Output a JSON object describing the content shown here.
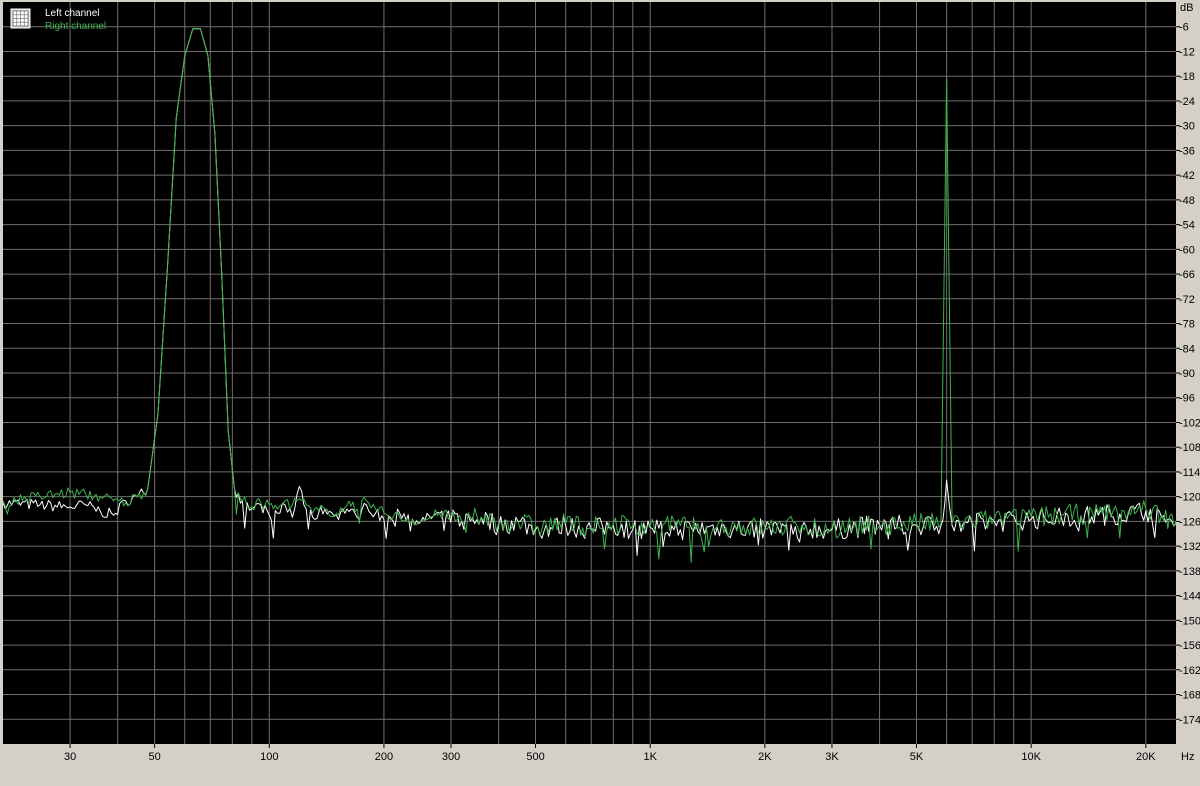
{
  "chart_data": {
    "type": "line",
    "title": "",
    "xlabel": "",
    "ylabel": "",
    "x_unit": "Hz",
    "y_unit": "dB",
    "x_scale": "log",
    "xlim": [
      20,
      24000
    ],
    "ylim": [
      -180,
      0
    ],
    "grid": true,
    "legend_position": "top-left",
    "x_ticks": [
      {
        "value": 30,
        "label": "30"
      },
      {
        "value": 50,
        "label": "50"
      },
      {
        "value": 100,
        "label": "100"
      },
      {
        "value": 200,
        "label": "200"
      },
      {
        "value": 300,
        "label": "300"
      },
      {
        "value": 500,
        "label": "500"
      },
      {
        "value": 1000,
        "label": "1K"
      },
      {
        "value": 2000,
        "label": "2K"
      },
      {
        "value": 3000,
        "label": "3K"
      },
      {
        "value": 5000,
        "label": "5K"
      },
      {
        "value": 10000,
        "label": "10K"
      },
      {
        "value": 20000,
        "label": "20K"
      }
    ],
    "x_minor_grid": [
      20,
      40,
      60,
      70,
      80,
      90,
      400,
      600,
      700,
      800,
      900,
      4000,
      6000,
      7000,
      8000,
      9000
    ],
    "y_ticks": [
      -6,
      -12,
      -18,
      -24,
      -30,
      -36,
      -42,
      -48,
      -54,
      -60,
      -66,
      -72,
      -78,
      -84,
      -90,
      -96,
      -102,
      -108,
      -114,
      -120,
      -126,
      -132,
      -138,
      -144,
      -150,
      -156,
      -162,
      -168,
      -174
    ],
    "series": [
      {
        "name": "Left channel",
        "color": "#ffffff",
        "points": [
          [
            20,
            -121.5
          ],
          [
            25,
            -122
          ],
          [
            30,
            -122.5
          ],
          [
            33,
            -122
          ],
          [
            36,
            -123.5
          ],
          [
            39,
            -124.5
          ],
          [
            42,
            -121
          ],
          [
            45,
            -120
          ],
          [
            48,
            -118
          ],
          [
            51,
            -100
          ],
          [
            54,
            -65
          ],
          [
            57,
            -28
          ],
          [
            60,
            -13
          ],
          [
            63,
            -6.5
          ],
          [
            66,
            -6.5
          ],
          [
            69,
            -13
          ],
          [
            72,
            -32
          ],
          [
            75,
            -66
          ],
          [
            78,
            -104
          ],
          [
            81,
            -118
          ],
          [
            85,
            -121
          ],
          [
            90,
            -123
          ],
          [
            95,
            -122
          ],
          [
            100,
            -124.5
          ],
          [
            105,
            -124
          ],
          [
            110,
            -122
          ],
          [
            115,
            -125
          ],
          [
            120,
            -117.5
          ],
          [
            125,
            -123
          ],
          [
            130,
            -125
          ],
          [
            140,
            -123
          ],
          [
            150,
            -124.5
          ],
          [
            160,
            -123
          ],
          [
            170,
            -125
          ],
          [
            180,
            -122
          ],
          [
            190,
            -124
          ],
          [
            200,
            -125.5
          ],
          [
            220,
            -124
          ],
          [
            250,
            -126
          ],
          [
            280,
            -124
          ],
          [
            320,
            -126
          ],
          [
            360,
            -125
          ],
          [
            400,
            -127
          ],
          [
            450,
            -126
          ],
          [
            500,
            -128
          ],
          [
            600,
            -127
          ],
          [
            700,
            -128
          ],
          [
            800,
            -127
          ],
          [
            900,
            -128
          ],
          [
            1000,
            -127.5
          ],
          [
            1200,
            -128
          ],
          [
            1500,
            -127.5
          ],
          [
            2000,
            -128
          ],
          [
            2500,
            -127.5
          ],
          [
            3000,
            -128
          ],
          [
            4000,
            -127
          ],
          [
            5000,
            -127
          ],
          [
            5800,
            -127
          ],
          [
            6000,
            -116
          ],
          [
            6200,
            -127
          ],
          [
            7000,
            -126.5
          ],
          [
            8000,
            -126
          ],
          [
            10000,
            -125.5
          ],
          [
            12000,
            -125
          ],
          [
            15000,
            -124.5
          ],
          [
            18000,
            -124
          ],
          [
            20000,
            -123.5
          ],
          [
            22000,
            -125
          ],
          [
            24000,
            -126.5
          ]
        ]
      },
      {
        "name": "Right channel",
        "color": "#3cb44b",
        "points": [
          [
            20,
            -121
          ],
          [
            25,
            -120
          ],
          [
            30,
            -119
          ],
          [
            33,
            -119.5
          ],
          [
            36,
            -120
          ],
          [
            39,
            -121
          ],
          [
            42,
            -121.5
          ],
          [
            45,
            -120
          ],
          [
            48,
            -118
          ],
          [
            51,
            -100
          ],
          [
            54,
            -65
          ],
          [
            57,
            -28
          ],
          [
            60,
            -13
          ],
          [
            63,
            -6.5
          ],
          [
            66,
            -6.5
          ],
          [
            69,
            -13
          ],
          [
            72,
            -32
          ],
          [
            75,
            -66
          ],
          [
            78,
            -104
          ],
          [
            81,
            -118
          ],
          [
            85,
            -121
          ],
          [
            90,
            -122.5
          ],
          [
            95,
            -121.5
          ],
          [
            100,
            -122
          ],
          [
            105,
            -123
          ],
          [
            110,
            -121
          ],
          [
            115,
            -122
          ],
          [
            120,
            -120.5
          ],
          [
            125,
            -122
          ],
          [
            130,
            -124
          ],
          [
            140,
            -123
          ],
          [
            150,
            -124
          ],
          [
            160,
            -122
          ],
          [
            170,
            -123
          ],
          [
            180,
            -121
          ],
          [
            190,
            -123
          ],
          [
            200,
            -124
          ],
          [
            220,
            -125
          ],
          [
            250,
            -126
          ],
          [
            280,
            -124
          ],
          [
            320,
            -126
          ],
          [
            360,
            -125
          ],
          [
            400,
            -126.5
          ],
          [
            450,
            -126
          ],
          [
            500,
            -127.5
          ],
          [
            600,
            -126.5
          ],
          [
            700,
            -127.5
          ],
          [
            800,
            -126.5
          ],
          [
            900,
            -127
          ],
          [
            1000,
            -127
          ],
          [
            1200,
            -127
          ],
          [
            1500,
            -127
          ],
          [
            2000,
            -127.5
          ],
          [
            2500,
            -127
          ],
          [
            3000,
            -127.5
          ],
          [
            4000,
            -127
          ],
          [
            5000,
            -126.5
          ],
          [
            5800,
            -126.5
          ],
          [
            6000,
            -18.5
          ],
          [
            6200,
            -126.5
          ],
          [
            7000,
            -126
          ],
          [
            8000,
            -125.5
          ],
          [
            10000,
            -125
          ],
          [
            12000,
            -124.5
          ],
          [
            15000,
            -124
          ],
          [
            18000,
            -123.5
          ],
          [
            20000,
            -123
          ],
          [
            22000,
            -124.5
          ],
          [
            24000,
            -126
          ]
        ]
      }
    ]
  },
  "legend": {
    "icon": "grid-icon",
    "entries": [
      {
        "label": "Left channel",
        "color": "#ffffff"
      },
      {
        "label": "Right channel",
        "color": "#3cb44b"
      }
    ]
  },
  "axis": {
    "y_unit_label": "dB",
    "x_unit_label": "Hz"
  },
  "colors": {
    "plot_background": "#000000",
    "grid": "#6e6e6e",
    "outer_background": "#d4d0c8"
  }
}
